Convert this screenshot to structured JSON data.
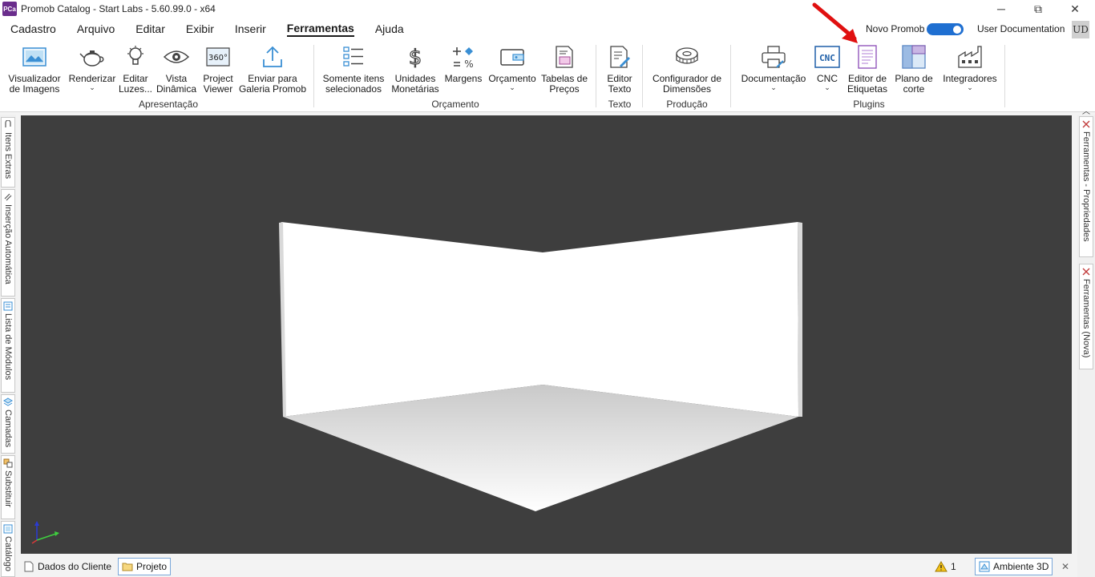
{
  "window": {
    "logo_text": "PCa",
    "title": "Promob Catalog - Start Labs - 5.60.99.0 - x64",
    "minimize": "─",
    "maximize": "⧉",
    "close": "✕"
  },
  "menu": {
    "items": [
      "Cadastro",
      "Arquivo",
      "Editar",
      "Exibir",
      "Inserir",
      "Ferramentas",
      "Ajuda"
    ],
    "active": "Ferramentas"
  },
  "header_right": {
    "novo_promob_label": "Novo Promob",
    "novo_promob_on": true,
    "user_label": "User Documentation",
    "avatar_initials": "UD"
  },
  "ribbon": {
    "groups": [
      "Apresentação",
      "Orçamento",
      "Texto",
      "Produção",
      "Plugins"
    ],
    "buttons": {
      "visualizador": "Visualizador\nde Imagens",
      "renderizar": "Renderizar",
      "editar_luzes": "Editar\nLuzes...",
      "vista_dinamica": "Vista\nDinâmica",
      "project_viewer": "Project\nViewer",
      "enviar_galeria": "Enviar para\nGaleria Promob",
      "somente_itens": "Somente itens\nselecionados",
      "unidades": "Unidades\nMonetárias",
      "margens": "Margens",
      "orcamento": "Orçamento",
      "tabelas": "Tabelas de\nPreços",
      "editor_texto": "Editor\nTexto",
      "configurador": "Configurador de\nDimensões",
      "documentacao": "Documentação",
      "cnc": "CNC",
      "editor_etiquetas": "Editor de\nEtiquetas",
      "plano_corte": "Plano de\ncorte",
      "integradores": "Integradores"
    },
    "icon_texts": {
      "vista360": "360°",
      "cnc": "CNC"
    },
    "accent_color": "#1f6fd1"
  },
  "left_tabs": [
    "Itens Extras",
    "Inserção Automática",
    "Lista de Módulos",
    "Camadas",
    "Substituir",
    "Catálogo"
  ],
  "right_tabs": [
    "Ferramentas - Propriedades",
    "Ferramentas (Nova)"
  ],
  "viewport": {
    "background": "#3e3e3e",
    "annotation": "red-arrow pointing to Editor de Etiquetas"
  },
  "statusbar": {
    "tabs": [
      "Dados do Cliente",
      "Projeto"
    ],
    "selected_tab": "Projeto",
    "warning_count": "1",
    "view_mode": "Ambiente 3D",
    "close": "✕"
  }
}
